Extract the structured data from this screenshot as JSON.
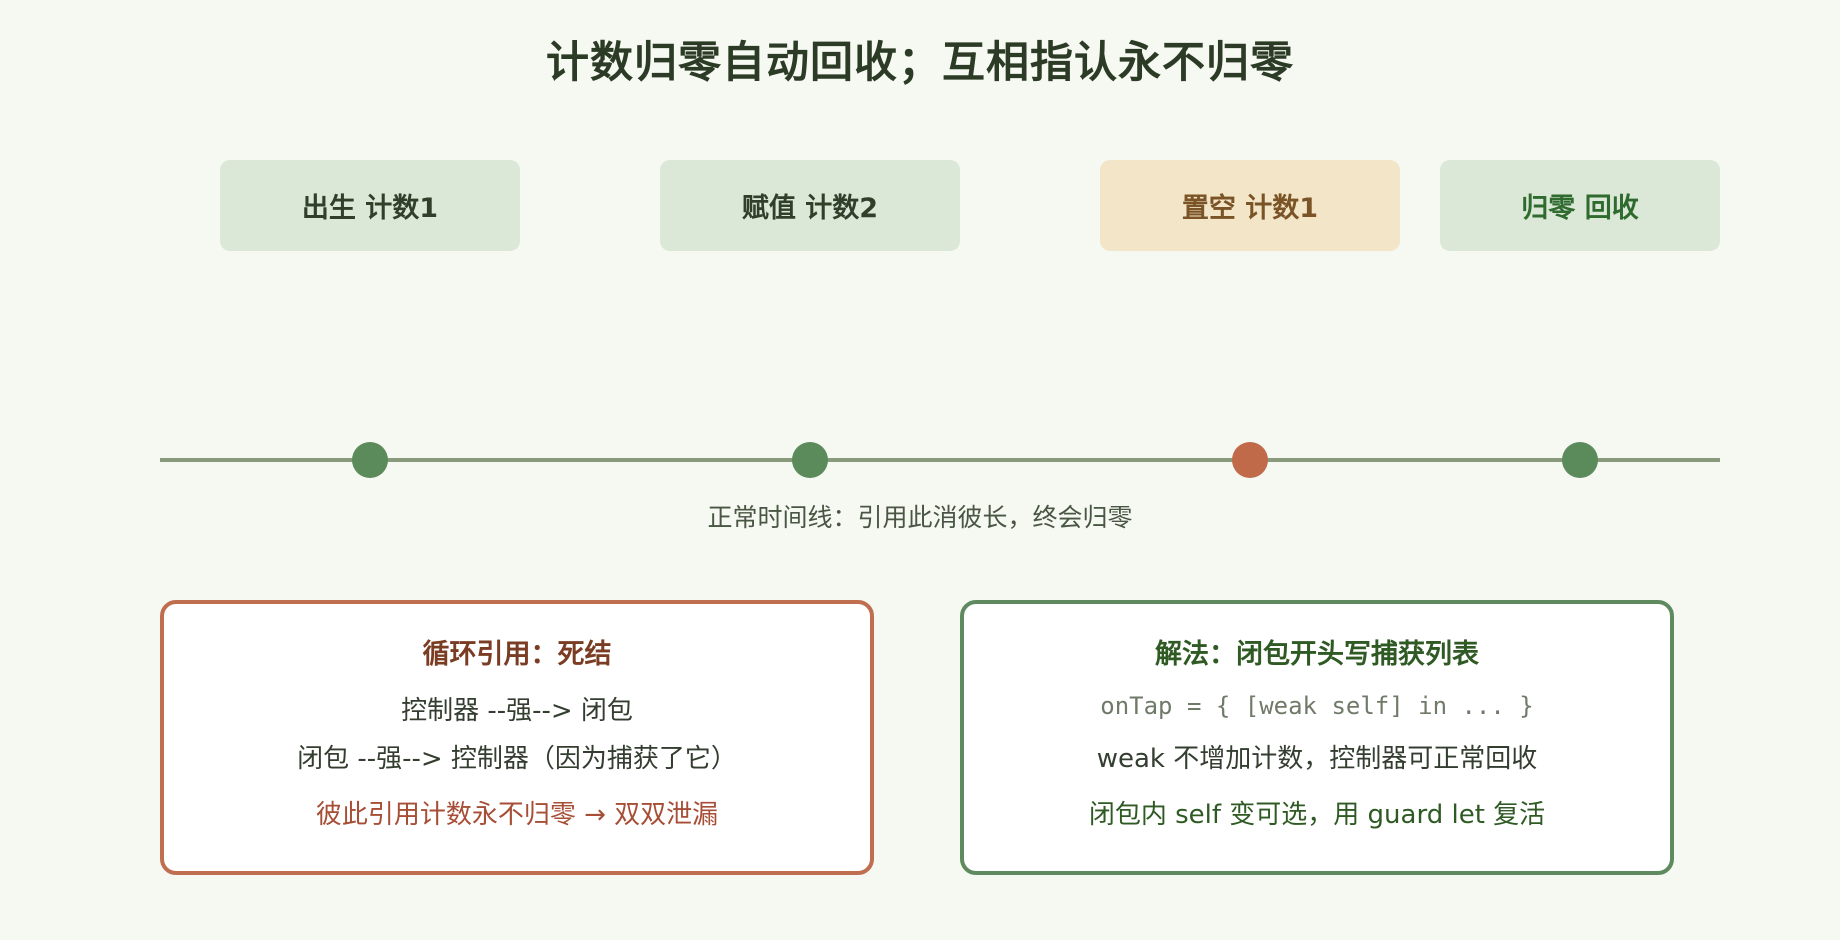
{
  "title": "计数归零自动回收；互相指认永不归零",
  "stages": [
    {
      "label": "出生 计数1"
    },
    {
      "label": "赋值 计数2"
    },
    {
      "label": "置空 计数1"
    },
    {
      "label": "归零 回收"
    }
  ],
  "timeline": {
    "caption": "正常时间线：引用此消彼长，终会归零"
  },
  "cycle_card": {
    "title": "循环引用：死结",
    "line1": "控制器 --强--> 闭包",
    "line2": "闭包 --强--> 控制器（因为捕获了它）",
    "line3": "彼此引用计数永不归零 → 双双泄漏"
  },
  "fix_card": {
    "title": "解法：闭包开头写捕获列表",
    "code": "onTap = { [weak self] in ... }",
    "line2": "weak 不增加计数，控制器可正常回收",
    "line3": "闭包内 self 变可选，用 guard let 复活"
  },
  "colors": {
    "background": "#f6f8f2",
    "stage_green": "#dce8d7",
    "stage_amber": "#f3e6c8",
    "dot_green": "#5b8a5b",
    "dot_orange": "#c06a4a",
    "cycle_border": "#bf6e50",
    "fix_border": "#5f8a5f"
  }
}
